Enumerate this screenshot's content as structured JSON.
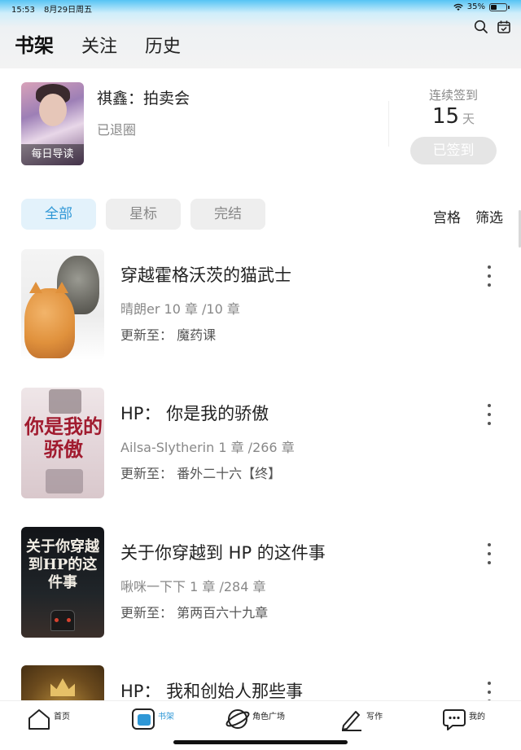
{
  "status_bar": {
    "time": "15:53",
    "date": "8月29日周五",
    "battery": "35%"
  },
  "header": {
    "tabs": [
      {
        "label": "书架",
        "active": true
      },
      {
        "label": "关注",
        "active": false
      },
      {
        "label": "历史",
        "active": false
      }
    ],
    "icons": [
      "search-icon",
      "calendar-check-icon"
    ]
  },
  "daily": {
    "cover_label": "每日导读",
    "title": "祺鑫：拍卖会",
    "status": "已退圈"
  },
  "checkin": {
    "label": "连续签到",
    "days": "15",
    "unit": "天",
    "button": "已签到"
  },
  "filters": {
    "chips": [
      {
        "label": "全部",
        "active": true
      },
      {
        "label": "星标",
        "active": false
      },
      {
        "label": "完结",
        "active": false
      }
    ],
    "grid": "宫格",
    "filter": "筛选"
  },
  "books": [
    {
      "title": "穿越霍格沃茨的猫武士",
      "meta": "晴朗er  10 章 /10 章",
      "update": "更新至：  魔药课"
    },
    {
      "title": "HP：  你是我的骄傲",
      "meta": "Ailsa-Slytherin  1 章 /266 章",
      "update": "更新至：  番外二十六【终】",
      "cover_text": "你是我的骄傲"
    },
    {
      "title": "关于你穿越到 HP 的这件事",
      "meta": "啾咪一下下  1 章 /284 章",
      "update": "更新至：  第两百六十九章",
      "cover_text": "关于你穿越到HP的这件事"
    },
    {
      "title": "HP：  我和创始人那些事",
      "meta": "",
      "update": ""
    }
  ],
  "bottom_nav": [
    {
      "label": "首页",
      "icon": "home-icon",
      "active": false
    },
    {
      "label": "书架",
      "icon": "bookshelf-icon",
      "active": true
    },
    {
      "label": "角色广场",
      "icon": "planet-icon",
      "active": false
    },
    {
      "label": "写作",
      "icon": "pen-icon",
      "active": false
    },
    {
      "label": "我的",
      "icon": "chat-bubble-icon",
      "active": false
    }
  ],
  "colors": {
    "accent": "#2e97d6",
    "chip_active_bg": "#e3f2fb"
  }
}
